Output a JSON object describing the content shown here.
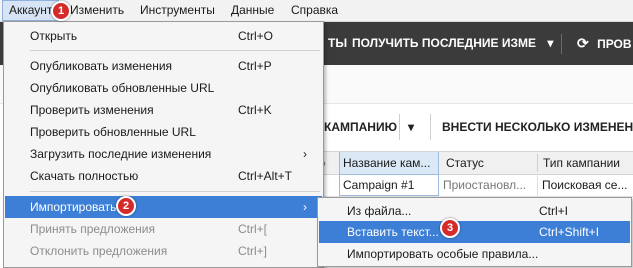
{
  "menubar": {
    "items": [
      "Аккаунт",
      "Изменить",
      "Инструменты",
      "Данные",
      "Справка"
    ]
  },
  "toolbar": {
    "items": [
      "ТЫ",
      "ПОЛУЧИТЬ ПОСЛЕДНИЕ ИЗМЕ",
      "ПРОВ"
    ],
    "dropdown_glyph": "▾",
    "refresh_glyph": "⟳"
  },
  "actions": {
    "add_campaign": "КАМПАНИЮ",
    "add_dropdown_glyph": "▾",
    "bulk_changes": "ВНЕСТИ НЕСКОЛЬКО ИЗМЕНЕНИ"
  },
  "grid": {
    "columns": [
      "Название кам...",
      "Статус",
      "Тип кампании"
    ],
    "rows": [
      {
        "name": "Campaign #1",
        "status": "Приостановл...",
        "type": "Поисковая се..."
      }
    ]
  },
  "account_menu": {
    "items": [
      {
        "label": "Открыть",
        "shortcut": "Ctrl+O"
      },
      {
        "label": "Опубликовать изменения",
        "shortcut": "Ctrl+P"
      },
      {
        "label": "Опубликовать обновленные URL",
        "shortcut": ""
      },
      {
        "label": "Проверить изменения",
        "shortcut": "Ctrl+K"
      },
      {
        "label": "Проверить обновленные URL",
        "shortcut": ""
      },
      {
        "label": "Загрузить последние изменения",
        "shortcut": ""
      },
      {
        "label": "Скачать полностью",
        "shortcut": "Ctrl+Alt+T"
      },
      {
        "label": "Импортировать",
        "shortcut": ""
      },
      {
        "label": "Принять предложения",
        "shortcut": "Ctrl+["
      },
      {
        "label": "Отклонить предложения",
        "shortcut": "Ctrl+]"
      }
    ],
    "submenu_arrow": "›"
  },
  "import_submenu": {
    "items": [
      {
        "label": "Из файла...",
        "shortcut": "Ctrl+I"
      },
      {
        "label": "Вставить текст...",
        "shortcut": "Ctrl+Shift+I"
      },
      {
        "label": "Импортировать особые правила...",
        "shortcut": ""
      }
    ]
  },
  "steps": [
    "1",
    "2",
    "3"
  ],
  "colors": {
    "menu_highlight": "#3d7fd6",
    "badge": "#d42a2a",
    "toolbar_bg": "#3b3b3b"
  }
}
